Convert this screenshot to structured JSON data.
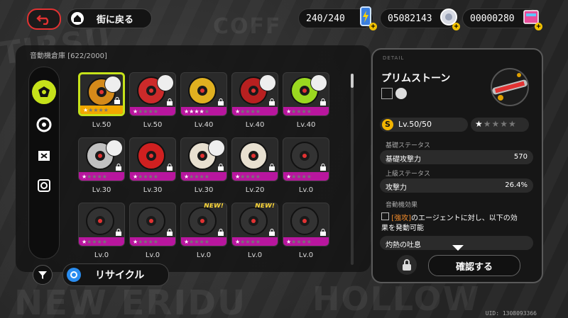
{
  "header": {
    "town_label": "街に戻る",
    "battery": "240/240",
    "coins": "05082143",
    "tickets": "00000280",
    "plus": "+"
  },
  "inventory": {
    "title": "音動機倉庫",
    "count": "[622/2000]",
    "items": [
      {
        "level": "Lv.50",
        "stars": 1,
        "selected": true,
        "new": false,
        "has_agent": true
      },
      {
        "level": "Lv.50",
        "stars": 1,
        "selected": false,
        "new": false,
        "has_agent": true
      },
      {
        "level": "Lv.40",
        "stars": 4,
        "selected": false,
        "new": false,
        "has_agent": false
      },
      {
        "level": "Lv.40",
        "stars": 1,
        "selected": false,
        "new": false,
        "has_agent": true
      },
      {
        "level": "Lv.40",
        "stars": 1,
        "selected": false,
        "new": false,
        "has_agent": true
      },
      {
        "level": "Lv.30",
        "stars": 1,
        "selected": false,
        "new": false,
        "has_agent": true
      },
      {
        "level": "Lv.30",
        "stars": 1,
        "selected": false,
        "new": false,
        "has_agent": false
      },
      {
        "level": "Lv.30",
        "stars": 1,
        "selected": false,
        "new": false,
        "has_agent": true
      },
      {
        "level": "Lv.20",
        "stars": 1,
        "selected": false,
        "new": false,
        "has_agent": false
      },
      {
        "level": "Lv.0",
        "stars": 1,
        "selected": false,
        "new": false,
        "has_agent": false
      },
      {
        "level": "Lv.0",
        "stars": 1,
        "selected": false,
        "new": false,
        "has_agent": false
      },
      {
        "level": "Lv.0",
        "stars": 1,
        "selected": false,
        "new": false,
        "has_agent": false
      },
      {
        "level": "Lv.0",
        "stars": 1,
        "selected": false,
        "new": true,
        "has_agent": false
      },
      {
        "level": "Lv.0",
        "stars": 1,
        "selected": false,
        "new": true,
        "has_agent": false
      },
      {
        "level": "Lv.0",
        "stars": 1,
        "selected": false,
        "new": false,
        "has_agent": false
      }
    ],
    "new_label": "NEW!"
  },
  "footer": {
    "recycle_label": "リサイクル"
  },
  "detail": {
    "tag": "DETAIL",
    "name": "プリムストーン",
    "level": "Lv.50/50",
    "stars": 1,
    "base_section": "基礎ステータス",
    "base_stat_name": "基礎攻撃力",
    "base_stat_value": "570",
    "adv_section": "上級ステータス",
    "adv_stat_name": "攻撃力",
    "adv_stat_value": "26.4%",
    "effect_section": "音動機効果",
    "effect_tag": "[強攻]",
    "effect_text_1": "のエージェントに対し、以下の効",
    "effect_text_2": "果を発動可能",
    "effect_name": "灼熱の吐息",
    "confirm_label": "確認する"
  },
  "uid": "UID: 1308093366",
  "colors": {
    "accent": "#c6e21a",
    "rarity_s": "#b8169e",
    "rarity_selected": "#f2a800",
    "back": "#e23232"
  }
}
